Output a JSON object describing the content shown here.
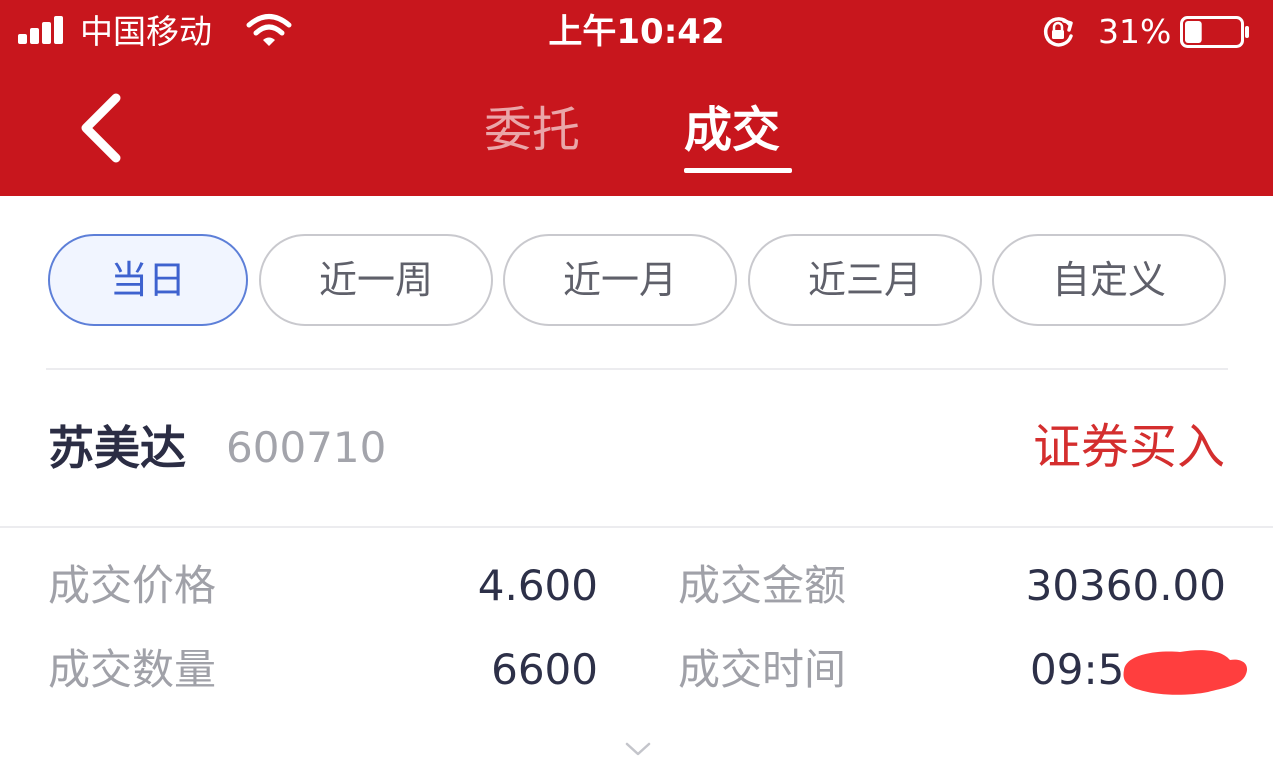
{
  "status_bar": {
    "carrier": "中国移动",
    "time": "上午10:42",
    "battery_percent": "31%",
    "battery_level": 0.31,
    "icons": [
      "signal-icon",
      "wifi-icon",
      "orientation-lock-icon",
      "battery-icon"
    ]
  },
  "nav": {
    "back_icon": "chevron-left-icon",
    "tabs": [
      {
        "label": "委托",
        "active": false
      },
      {
        "label": "成交",
        "active": true
      }
    ]
  },
  "filters": [
    {
      "label": "当日",
      "active": true
    },
    {
      "label": "近一周",
      "active": false
    },
    {
      "label": "近一月",
      "active": false
    },
    {
      "label": "近三月",
      "active": false
    },
    {
      "label": "自定义",
      "active": false
    }
  ],
  "record": {
    "stock_name": "苏美达",
    "stock_code": "600710",
    "trade_type": "证券买入",
    "details": {
      "price_label": "成交价格",
      "price_value": "4.600",
      "amount_label": "成交金额",
      "amount_value": "30360.00",
      "quantity_label": "成交数量",
      "quantity_value": "6600",
      "time_label": "成交时间",
      "time_value": "09:5"
    },
    "expand_icon": "chevron-down-icon"
  },
  "colors": {
    "header_red": "#c8161d",
    "active_blue": "#3e62cf",
    "trade_red": "#d42e2e",
    "redaction_red": "#ff3e3e"
  }
}
